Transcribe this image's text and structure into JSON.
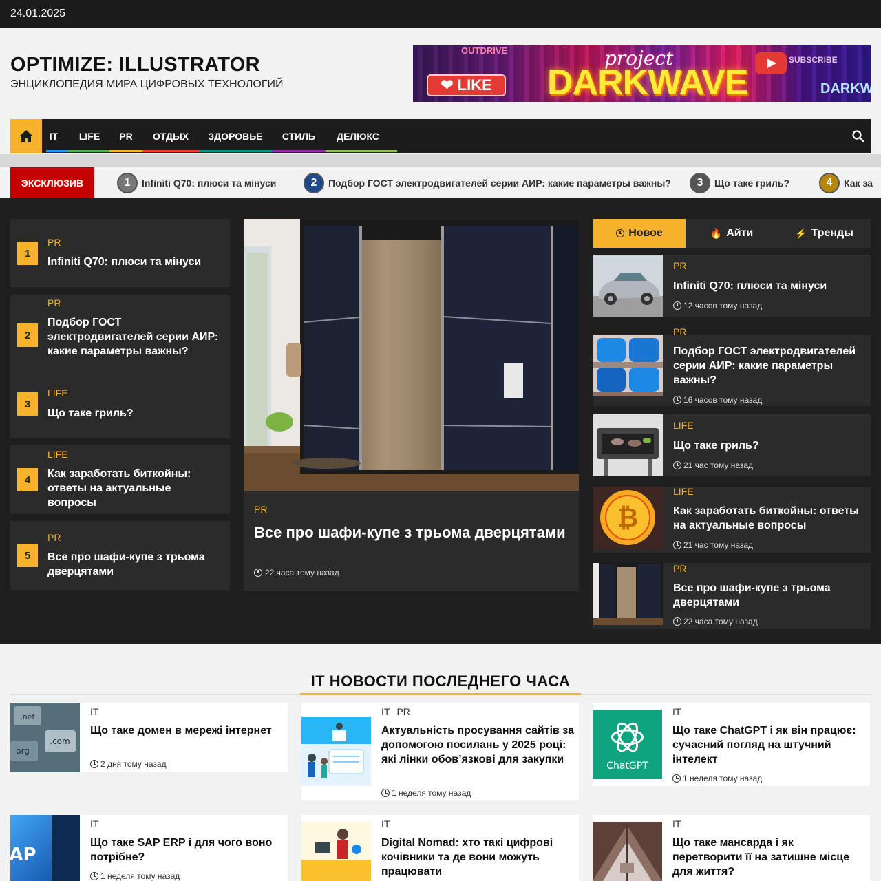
{
  "topbar": {
    "date": "24.01.2025"
  },
  "header": {
    "title": "OPTIMIZE: ILLUSTRATOR",
    "tagline": "ЭНЦИКЛОПЕДИЯ МИРА ЦИФРОВЫХ ТЕХНОЛОГИЙ",
    "banner": {
      "outdrive": "OUTDRIVE",
      "like": "LIKE",
      "project": "project",
      "darkwave": "DARKWAVE",
      "subscribe": "SUBSCRIBE",
      "darkwave_small": "DARKWAV"
    }
  },
  "nav": {
    "home_icon": "home-icon",
    "items": [
      {
        "label": "IT",
        "color": "#2196f3"
      },
      {
        "label": "LIFE",
        "color": "#4caf50"
      },
      {
        "label": "PR",
        "color": "#f5b22a"
      },
      {
        "label": "ОТДЫХ",
        "color": "#f44336"
      },
      {
        "label": "ЗДОРОВЬЕ",
        "color": "#009688"
      },
      {
        "label": "СТИЛЬ",
        "color": "#9c27b0"
      },
      {
        "label": "ДЕЛЮКС",
        "color": "#8bc34a"
      }
    ],
    "search_icon": "search-icon"
  },
  "ticker": {
    "label": "ЭКСКЛЮЗИВ",
    "items": [
      {
        "num": "1",
        "text": "Infiniti Q70: плюси та мінуси"
      },
      {
        "num": "2",
        "text": "Подбор ГОСТ электродвигателей серии АИР: какие параметры важны?"
      },
      {
        "num": "3",
        "text": "Що таке гриль?"
      },
      {
        "num": "4",
        "text": "Как за"
      }
    ]
  },
  "ranked": [
    {
      "num": "1",
      "cat": "PR",
      "title": "Infiniti Q70: плюси та мінуси"
    },
    {
      "num": "2",
      "cat": "PR",
      "title": "Подбор ГОСТ электродвигателей серии АИР: какие параметры важны?"
    },
    {
      "num": "3",
      "cat": "LIFE",
      "title": "Що таке гриль?"
    },
    {
      "num": "4",
      "cat": "LIFE",
      "title": "Как заработать биткойны: ответы на актуальные вопросы"
    },
    {
      "num": "5",
      "cat": "PR",
      "title": "Все про шафи-купе з трьома дверцятами"
    }
  ],
  "hero": {
    "cat": "PR",
    "title": "Все про шафи-купе з трьома дверцятами",
    "time": "22 часа тому назад"
  },
  "tabs": [
    {
      "label": "Новое",
      "icon": "clock-icon",
      "active": true
    },
    {
      "label": "Айти",
      "icon": "fire-icon",
      "active": false
    },
    {
      "label": "Тренды",
      "icon": "bolt-icon",
      "active": false
    }
  ],
  "side_posts": [
    {
      "cat": "PR",
      "title": "Infiniti Q70: плюси та мінуси",
      "time": "12 часов тому назад"
    },
    {
      "cat": "PR",
      "title": "Подбор ГОСТ электродвигателей серии АИР: какие параметры важны?",
      "time": "16 часов тому назад"
    },
    {
      "cat": "LIFE",
      "title": "Що таке гриль?",
      "time": "21 час тому назад"
    },
    {
      "cat": "LIFE",
      "title": "Как заработать биткойны: ответы на актуальные вопросы",
      "time": "21 час тому назад"
    },
    {
      "cat": "PR",
      "title": "Все про шафи-купе з трьома дверцятами",
      "time": "22 часа тому назад"
    }
  ],
  "it_section": {
    "title": "IT НОВОСТИ ПОСЛЕДНЕГО ЧАСА",
    "posts": [
      {
        "cats": [
          "IT"
        ],
        "title": "Що таке домен в мережі інтернет",
        "time": "2 дня тому назад",
        "thumb_text": [
          ".net",
          ".com",
          "org"
        ]
      },
      {
        "cats": [
          "IT",
          "PR"
        ],
        "title": "Актуальність просування сайтів за допомогою посилань у 2025 році: які лінки обов’язкові для закупки",
        "time": "1 неделя тому назад"
      },
      {
        "cats": [
          "IT"
        ],
        "title": "Що таке ChatGPT і як він працює: сучасний погляд на штучний інтелект",
        "time": "1 неделя тому назад",
        "thumb_text": [
          "ChatGPT"
        ]
      },
      {
        "cats": [
          "IT"
        ],
        "title": "Що таке SAP ERP і для чого воно потрібне?",
        "time": "1 неделя тому назад",
        "thumb_text": [
          "AP"
        ]
      },
      {
        "cats": [
          "IT"
        ],
        "title": "Digital Nomad: хто такі цифрові кочівники та де вони можуть працювати",
        "time": ""
      },
      {
        "cats": [
          "IT"
        ],
        "title": "Що таке мансарда і як перетворити її на затишне місце для життя?",
        "time": ""
      }
    ]
  }
}
